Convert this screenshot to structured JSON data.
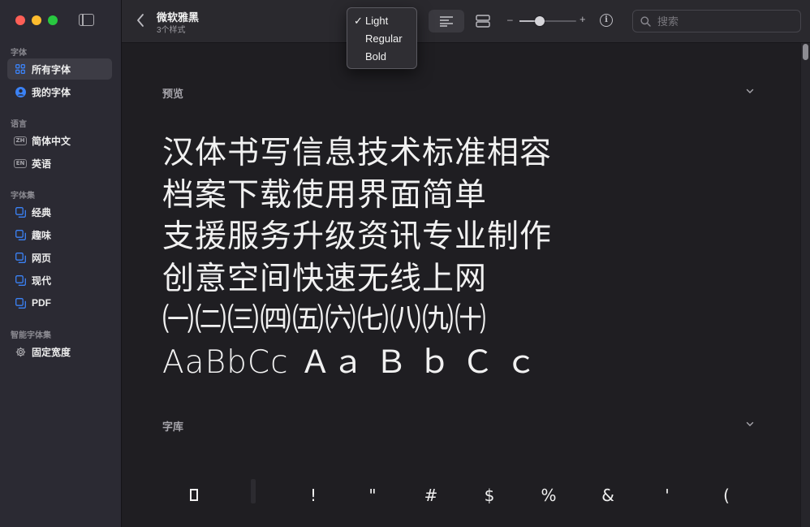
{
  "sidebar": {
    "sections": [
      {
        "label": "字体",
        "items": [
          {
            "label": "所有字体",
            "icon": "grid-icon",
            "active": true
          },
          {
            "label": "我的字体",
            "icon": "user-circle-icon",
            "active": false
          }
        ]
      },
      {
        "label": "语言",
        "items": [
          {
            "label": "简体中文",
            "badge": "ZH"
          },
          {
            "label": "英语",
            "badge": "EN"
          }
        ]
      },
      {
        "label": "字体集",
        "items": [
          {
            "label": "经典",
            "icon": "collection-icon"
          },
          {
            "label": "趣味",
            "icon": "collection-icon"
          },
          {
            "label": "网页",
            "icon": "collection-icon"
          },
          {
            "label": "现代",
            "icon": "collection-icon"
          },
          {
            "label": "PDF",
            "icon": "collection-icon"
          }
        ]
      },
      {
        "label": "智能字体集",
        "items": [
          {
            "label": "固定宽度",
            "icon": "gear-icon"
          }
        ]
      }
    ]
  },
  "toolbar": {
    "title": "微软雅黑",
    "subtitle": "3个样式",
    "search_placeholder": "搜索"
  },
  "style_menu": {
    "checkmark": "✓",
    "items": [
      "Light",
      "Regular",
      "Bold"
    ],
    "selected": "Light"
  },
  "content": {
    "preview_heading": "预览",
    "preview_lines": [
      "汉体书写信息技术标准相容",
      "档案下载使用界面简单",
      "支援服务升级资讯专业制作",
      "创意空间快速无线上网",
      "㈠㈡㈢㈣㈤㈥㈦㈧㈨㈩",
      "AaBbCc Ａａ Ｂ ｂ Ｃ ｃ"
    ],
    "repertoire_heading": "字库",
    "glyphs": [
      "!",
      "\"",
      "#",
      "$",
      "%",
      "&",
      "'",
      "("
    ]
  },
  "colors": {
    "accent": "#3b82f6",
    "sidebar_bg": "#2b2a33",
    "content_bg": "#1f1e22"
  }
}
